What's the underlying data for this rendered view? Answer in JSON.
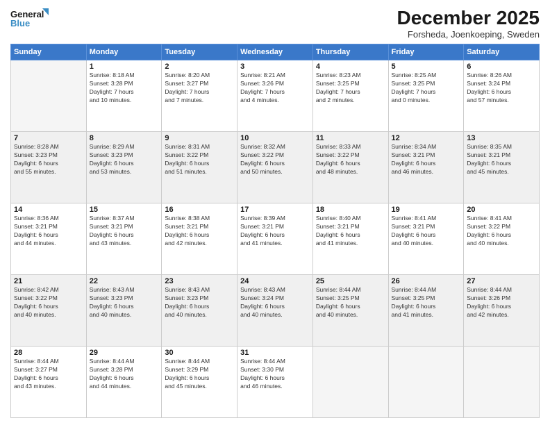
{
  "header": {
    "logo": {
      "line1": "General",
      "line2": "Blue"
    },
    "title": "December 2025",
    "subtitle": "Forsheda, Joenkoeping, Sweden"
  },
  "days_header": [
    "Sunday",
    "Monday",
    "Tuesday",
    "Wednesday",
    "Thursday",
    "Friday",
    "Saturday"
  ],
  "weeks": [
    [
      {
        "day": "",
        "info": ""
      },
      {
        "day": "1",
        "info": "Sunrise: 8:18 AM\nSunset: 3:28 PM\nDaylight: 7 hours\nand 10 minutes."
      },
      {
        "day": "2",
        "info": "Sunrise: 8:20 AM\nSunset: 3:27 PM\nDaylight: 7 hours\nand 7 minutes."
      },
      {
        "day": "3",
        "info": "Sunrise: 8:21 AM\nSunset: 3:26 PM\nDaylight: 7 hours\nand 4 minutes."
      },
      {
        "day": "4",
        "info": "Sunrise: 8:23 AM\nSunset: 3:25 PM\nDaylight: 7 hours\nand 2 minutes."
      },
      {
        "day": "5",
        "info": "Sunrise: 8:25 AM\nSunset: 3:25 PM\nDaylight: 7 hours\nand 0 minutes."
      },
      {
        "day": "6",
        "info": "Sunrise: 8:26 AM\nSunset: 3:24 PM\nDaylight: 6 hours\nand 57 minutes."
      }
    ],
    [
      {
        "day": "7",
        "info": "Sunrise: 8:28 AM\nSunset: 3:23 PM\nDaylight: 6 hours\nand 55 minutes."
      },
      {
        "day": "8",
        "info": "Sunrise: 8:29 AM\nSunset: 3:23 PM\nDaylight: 6 hours\nand 53 minutes."
      },
      {
        "day": "9",
        "info": "Sunrise: 8:31 AM\nSunset: 3:22 PM\nDaylight: 6 hours\nand 51 minutes."
      },
      {
        "day": "10",
        "info": "Sunrise: 8:32 AM\nSunset: 3:22 PM\nDaylight: 6 hours\nand 50 minutes."
      },
      {
        "day": "11",
        "info": "Sunrise: 8:33 AM\nSunset: 3:22 PM\nDaylight: 6 hours\nand 48 minutes."
      },
      {
        "day": "12",
        "info": "Sunrise: 8:34 AM\nSunset: 3:21 PM\nDaylight: 6 hours\nand 46 minutes."
      },
      {
        "day": "13",
        "info": "Sunrise: 8:35 AM\nSunset: 3:21 PM\nDaylight: 6 hours\nand 45 minutes."
      }
    ],
    [
      {
        "day": "14",
        "info": "Sunrise: 8:36 AM\nSunset: 3:21 PM\nDaylight: 6 hours\nand 44 minutes."
      },
      {
        "day": "15",
        "info": "Sunrise: 8:37 AM\nSunset: 3:21 PM\nDaylight: 6 hours\nand 43 minutes."
      },
      {
        "day": "16",
        "info": "Sunrise: 8:38 AM\nSunset: 3:21 PM\nDaylight: 6 hours\nand 42 minutes."
      },
      {
        "day": "17",
        "info": "Sunrise: 8:39 AM\nSunset: 3:21 PM\nDaylight: 6 hours\nand 41 minutes."
      },
      {
        "day": "18",
        "info": "Sunrise: 8:40 AM\nSunset: 3:21 PM\nDaylight: 6 hours\nand 41 minutes."
      },
      {
        "day": "19",
        "info": "Sunrise: 8:41 AM\nSunset: 3:21 PM\nDaylight: 6 hours\nand 40 minutes."
      },
      {
        "day": "20",
        "info": "Sunrise: 8:41 AM\nSunset: 3:22 PM\nDaylight: 6 hours\nand 40 minutes."
      }
    ],
    [
      {
        "day": "21",
        "info": "Sunrise: 8:42 AM\nSunset: 3:22 PM\nDaylight: 6 hours\nand 40 minutes."
      },
      {
        "day": "22",
        "info": "Sunrise: 8:43 AM\nSunset: 3:23 PM\nDaylight: 6 hours\nand 40 minutes."
      },
      {
        "day": "23",
        "info": "Sunrise: 8:43 AM\nSunset: 3:23 PM\nDaylight: 6 hours\nand 40 minutes."
      },
      {
        "day": "24",
        "info": "Sunrise: 8:43 AM\nSunset: 3:24 PM\nDaylight: 6 hours\nand 40 minutes."
      },
      {
        "day": "25",
        "info": "Sunrise: 8:44 AM\nSunset: 3:25 PM\nDaylight: 6 hours\nand 40 minutes."
      },
      {
        "day": "26",
        "info": "Sunrise: 8:44 AM\nSunset: 3:25 PM\nDaylight: 6 hours\nand 41 minutes."
      },
      {
        "day": "27",
        "info": "Sunrise: 8:44 AM\nSunset: 3:26 PM\nDaylight: 6 hours\nand 42 minutes."
      }
    ],
    [
      {
        "day": "28",
        "info": "Sunrise: 8:44 AM\nSunset: 3:27 PM\nDaylight: 6 hours\nand 43 minutes."
      },
      {
        "day": "29",
        "info": "Sunrise: 8:44 AM\nSunset: 3:28 PM\nDaylight: 6 hours\nand 44 minutes."
      },
      {
        "day": "30",
        "info": "Sunrise: 8:44 AM\nSunset: 3:29 PM\nDaylight: 6 hours\nand 45 minutes."
      },
      {
        "day": "31",
        "info": "Sunrise: 8:44 AM\nSunset: 3:30 PM\nDaylight: 6 hours\nand 46 minutes."
      },
      {
        "day": "",
        "info": ""
      },
      {
        "day": "",
        "info": ""
      },
      {
        "day": "",
        "info": ""
      }
    ]
  ],
  "row_classes": [
    "row-white",
    "row-shaded",
    "row-white",
    "row-shaded",
    "row-white"
  ]
}
